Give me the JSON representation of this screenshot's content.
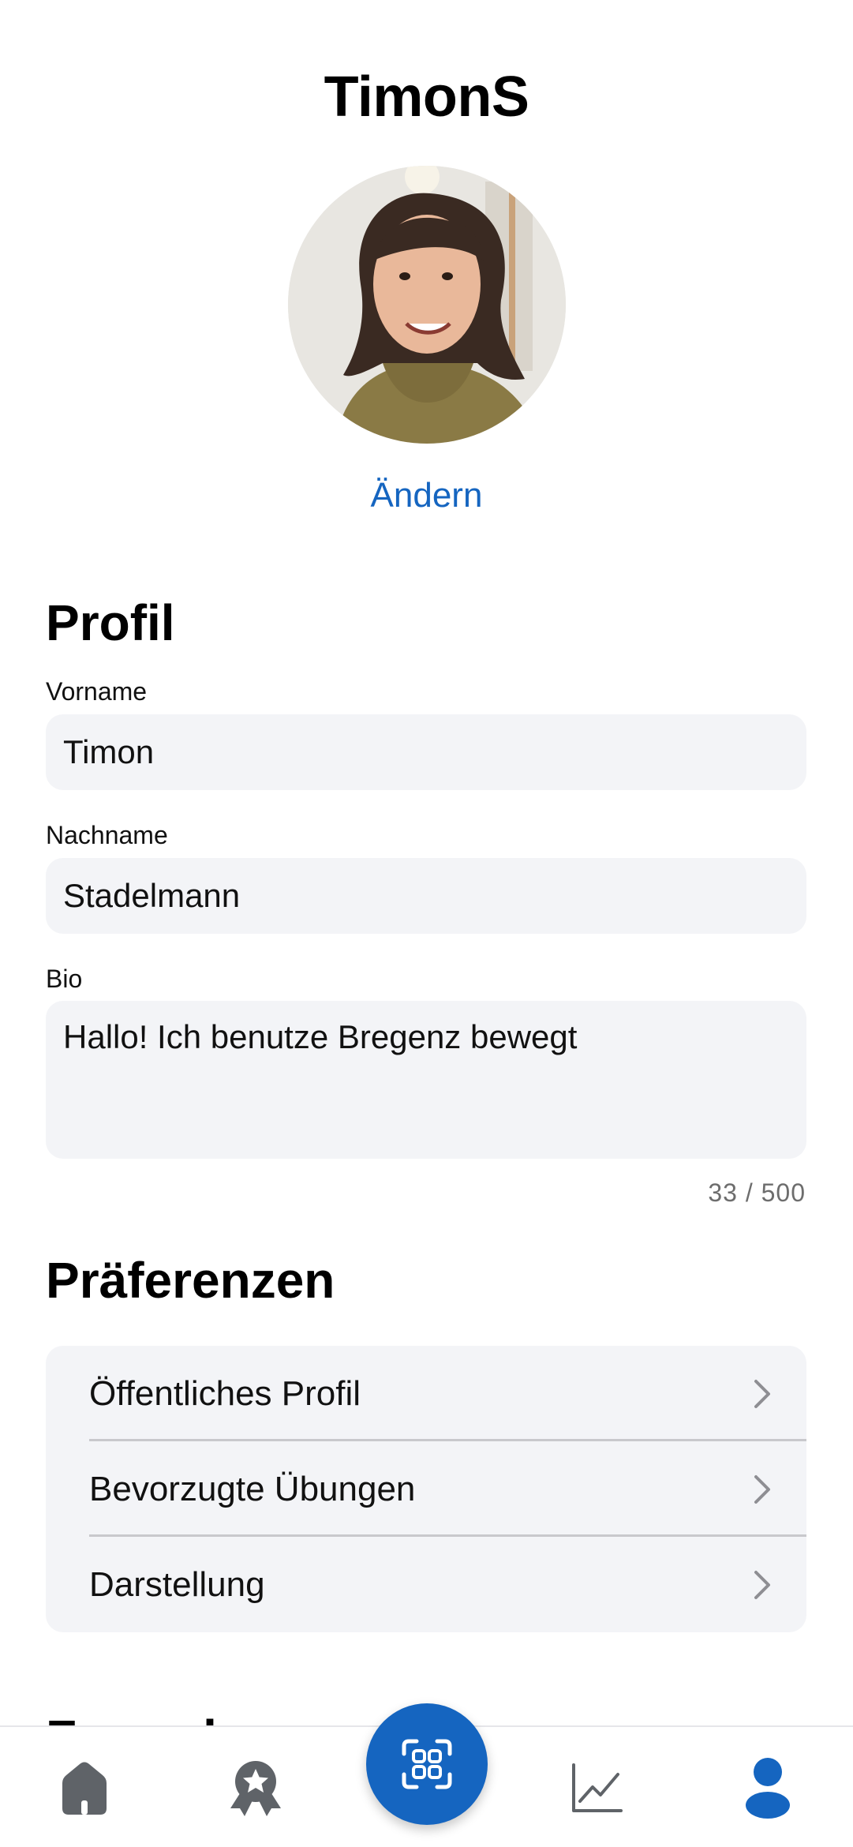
{
  "header": {
    "username": "TimonS"
  },
  "avatar": {
    "change_label": "Ändern"
  },
  "profile": {
    "title": "Profil",
    "first_name_label": "Vorname",
    "first_name_value": "Timon",
    "last_name_label": "Nachname",
    "last_name_value": "Stadelmann",
    "bio_label": "Bio",
    "bio_value": "Hallo! Ich benutze Bregenz bewegt",
    "bio_counter": "33 / 500"
  },
  "preferences": {
    "title": "Präferenzen",
    "items": [
      {
        "label": "Öffentliches Profil"
      },
      {
        "label": "Bevorzugte Übungen"
      },
      {
        "label": "Darstellung"
      }
    ]
  },
  "next_section": {
    "title": "Freunde"
  },
  "tabbar": {
    "items": [
      {
        "icon": "home-icon",
        "active": false
      },
      {
        "icon": "award-icon",
        "active": false
      },
      {
        "icon": "scan-icon",
        "active": false
      },
      {
        "icon": "chart-line-icon",
        "active": false
      },
      {
        "icon": "user-icon",
        "active": true
      }
    ]
  },
  "colors": {
    "accent": "#1565c0",
    "field_bg": "#f3f4f7",
    "icon_inactive": "#5f6368"
  }
}
